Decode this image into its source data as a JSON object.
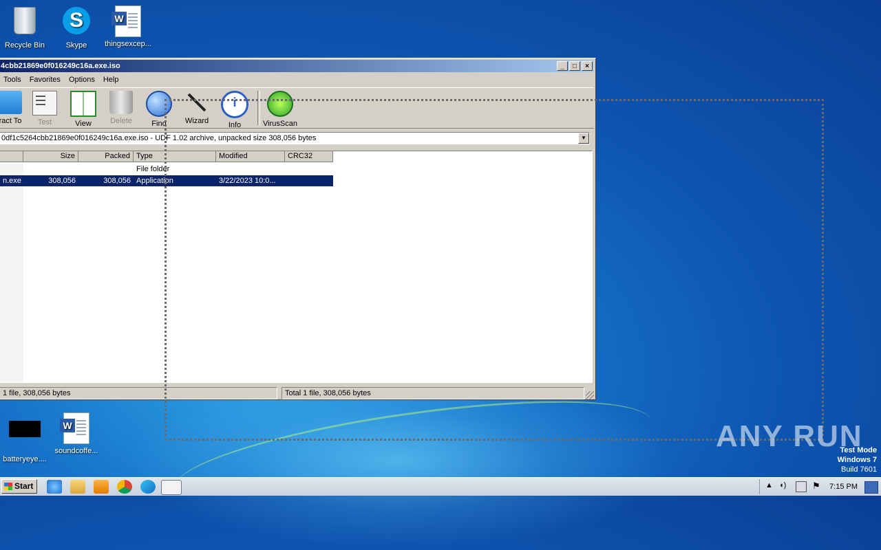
{
  "desktop": {
    "icons": [
      {
        "label": "Recycle Bin"
      },
      {
        "label": "Skype"
      },
      {
        "label": "thingsexcep..."
      },
      {
        "label": "batteryeye...."
      },
      {
        "label": "soundcoffe..."
      }
    ],
    "watermark": "ANY RUN",
    "test_mode": {
      "line1": "Test Mode",
      "line2": "Windows 7",
      "line3": "Build 7601"
    }
  },
  "window": {
    "title": "4cbb21869e0f016249c16a.exe.iso",
    "controls": {
      "minimize": "_",
      "maximize": "□",
      "close": "×"
    },
    "menu": [
      "Tools",
      "Favorites",
      "Options",
      "Help"
    ],
    "toolbar": [
      {
        "label": "ract To",
        "icon": "extract-to-icon",
        "disabled": false
      },
      {
        "label": "Test",
        "icon": "test-icon",
        "disabled": true
      },
      {
        "label": "View",
        "icon": "view-icon",
        "disabled": false
      },
      {
        "label": "Delete",
        "icon": "delete-icon",
        "disabled": true
      },
      {
        "label": "Find",
        "icon": "find-icon",
        "disabled": false
      },
      {
        "label": "Wizard",
        "icon": "wizard-icon",
        "disabled": false
      },
      {
        "label": "Info",
        "icon": "info-icon",
        "disabled": false
      },
      {
        "label": "VirusScan",
        "icon": "virusscan-icon",
        "disabled": false
      }
    ],
    "address": "0df1c5264cbb21869e0f016249c16a.exe.iso - UDF 1.02 archive, unpacked size 308,056 bytes",
    "columns": [
      "",
      "Size",
      "Packed",
      "Type",
      "Modified",
      "CRC32"
    ],
    "rows": [
      {
        "name": "",
        "size": "",
        "packed": "",
        "type": "File folder",
        "modified": "",
        "crc": "",
        "selected": false
      },
      {
        "name": "n.exe",
        "size": "308,056",
        "packed": "308,056",
        "type": "Application",
        "modified": "3/22/2023 10:0...",
        "crc": "",
        "selected": true
      }
    ],
    "status_left": "1 file, 308,056 bytes",
    "status_right": "Total 1 file, 308,056 bytes"
  },
  "taskbar": {
    "start_label": "Start",
    "clock": "7:15 PM"
  }
}
